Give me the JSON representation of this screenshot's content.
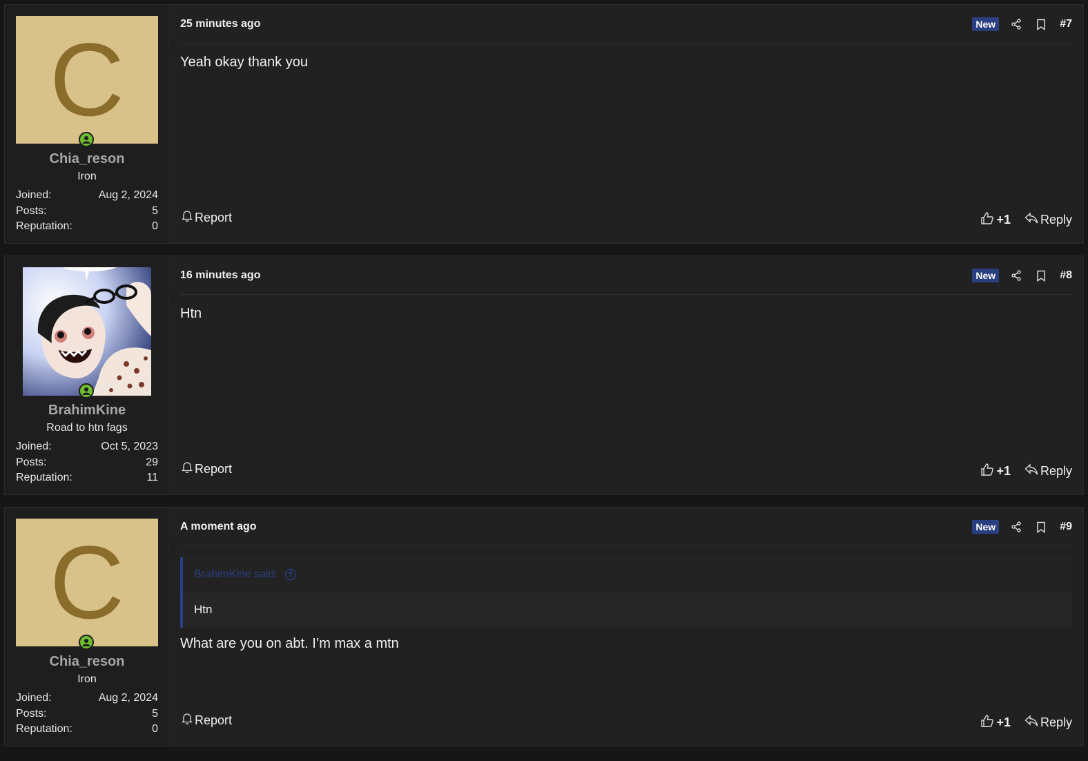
{
  "colors": {
    "accent": "#2a3f80",
    "online": "#6fbe2f",
    "avatar_bg": "#d8c289",
    "avatar_letter": "#8b6d2b"
  },
  "labels": {
    "new": "New",
    "joined": "Joined:",
    "posts": "Posts:",
    "reputation": "Reputation:",
    "report": "Report",
    "plus_one": "+1",
    "reply": "Reply"
  },
  "posts": [
    {
      "author": "Chia_reson",
      "avatar_letter": "C",
      "user_title": "Iron",
      "joined": "Aug 2, 2024",
      "post_count": "5",
      "reputation": "0",
      "date": "25 minutes ago",
      "number": "#7",
      "body": "Yeah okay thank you"
    },
    {
      "author": "BrahimKine",
      "user_title": "Road to htn fags",
      "joined": "Oct 5, 2023",
      "post_count": "29",
      "reputation": "11",
      "date": "16 minutes ago",
      "number": "#8",
      "body": "Htn"
    },
    {
      "author": "Chia_reson",
      "avatar_letter": "C",
      "user_title": "Iron",
      "joined": "Aug 2, 2024",
      "post_count": "5",
      "reputation": "0",
      "date": "A moment ago",
      "number": "#9",
      "quote_author": "BrahimKine said:",
      "quote_text": "Htn",
      "body": "What are you on abt. I’m max a mtn"
    }
  ]
}
